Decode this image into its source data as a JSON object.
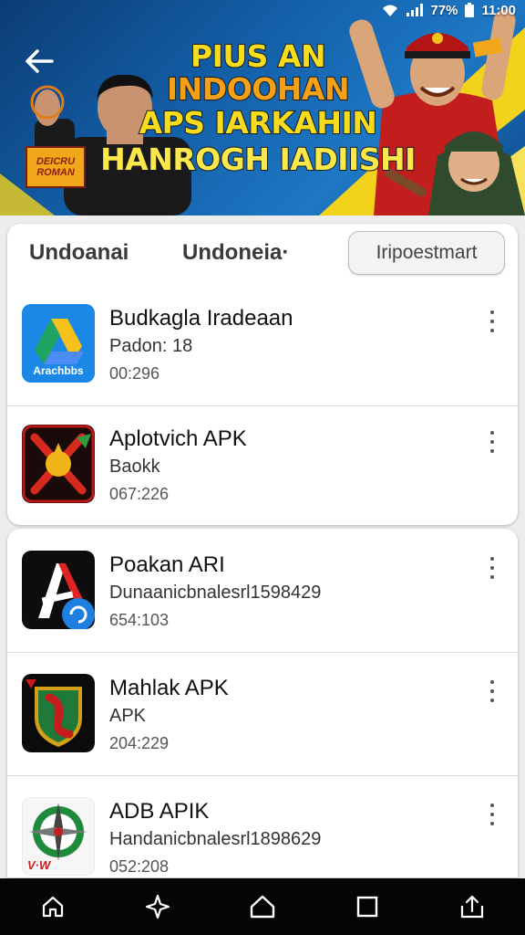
{
  "status_bar": {
    "battery": "77%",
    "time": "11:00"
  },
  "banner": {
    "headline_line1_a": "PIUS AN ",
    "headline_line1_b": "INDOOHAN",
    "headline_line2": "APS IARKAHIN",
    "headline_line3": "HANROGH IADIISHI",
    "badge_line1": "DEICRU",
    "badge_line2": "ROMAN"
  },
  "tabs": [
    {
      "label": "Undoanai"
    },
    {
      "label": "Undoneia·"
    }
  ],
  "action_button": {
    "label": "Iripoestmart"
  },
  "apps": [
    {
      "title": "Budkagla Iradeaan",
      "subtitle": "Padon: 18",
      "meta": "00:296",
      "icon": "drive-style-icon",
      "icon_label": "Arachbbs"
    },
    {
      "title": "Aplotvich APK",
      "subtitle": "Baokk",
      "meta": "067:226",
      "icon": "sword-emblem-icon"
    },
    {
      "title": "Poakan ARI",
      "subtitle": "Dunaanicbnalesrl1598429",
      "meta": "654:103",
      "icon": "letter-a-logo-icon"
    },
    {
      "title": "Mahlak APK",
      "subtitle": "APK",
      "meta": "204:229",
      "icon": "green-shield-icon"
    },
    {
      "title": "ADB APIK",
      "subtitle": "Handanicbnalesrl1898629",
      "meta": "052:208",
      "icon": "compass-icon",
      "icon_label": "V·W"
    }
  ],
  "colors": {
    "banner_blue": "#135fa8",
    "accent_yellow": "#f7dc1e",
    "navbar": "#050505"
  }
}
